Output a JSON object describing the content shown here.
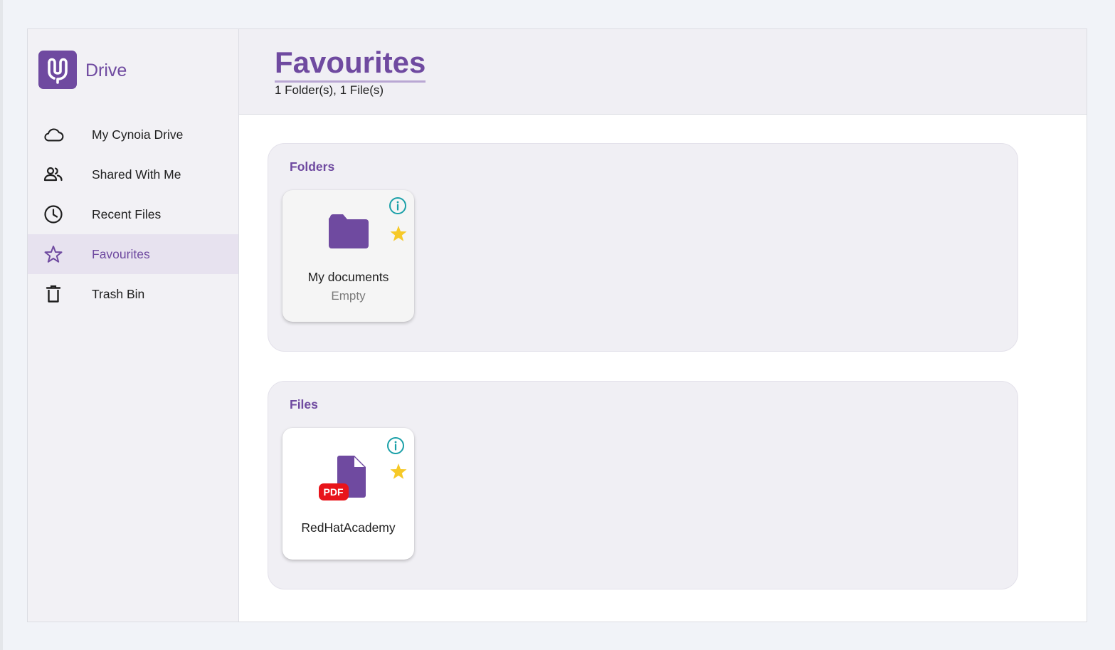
{
  "brand": {
    "name": "Drive",
    "logo_icon": "cynoia-logo-icon",
    "accent_color": "#6f4aa0"
  },
  "sidebar": {
    "items": [
      {
        "label": "My Cynoia Drive",
        "icon": "cloud-icon",
        "active": false
      },
      {
        "label": "Shared With Me",
        "icon": "people-icon",
        "active": false
      },
      {
        "label": "Recent Files",
        "icon": "clock-icon",
        "active": false
      },
      {
        "label": "Favourites",
        "icon": "star-outline-icon",
        "active": true
      },
      {
        "label": "Trash Bin",
        "icon": "trash-icon",
        "active": false
      }
    ]
  },
  "header": {
    "title": "Favourites",
    "subtitle": "1 Folder(s), 1 File(s)"
  },
  "sections": {
    "folders": {
      "title": "Folders",
      "items": [
        {
          "name": "My documents",
          "meta": "Empty",
          "icon": "folder-icon",
          "favourite": true
        }
      ]
    },
    "files": {
      "title": "Files",
      "items": [
        {
          "name": "RedHatAcademy",
          "type_badge": "PDF",
          "icon": "file-icon",
          "favourite": true
        }
      ]
    }
  },
  "colors": {
    "info": "#1aa0a8",
    "star": "#f6c928",
    "pdf": "#e8141b"
  }
}
